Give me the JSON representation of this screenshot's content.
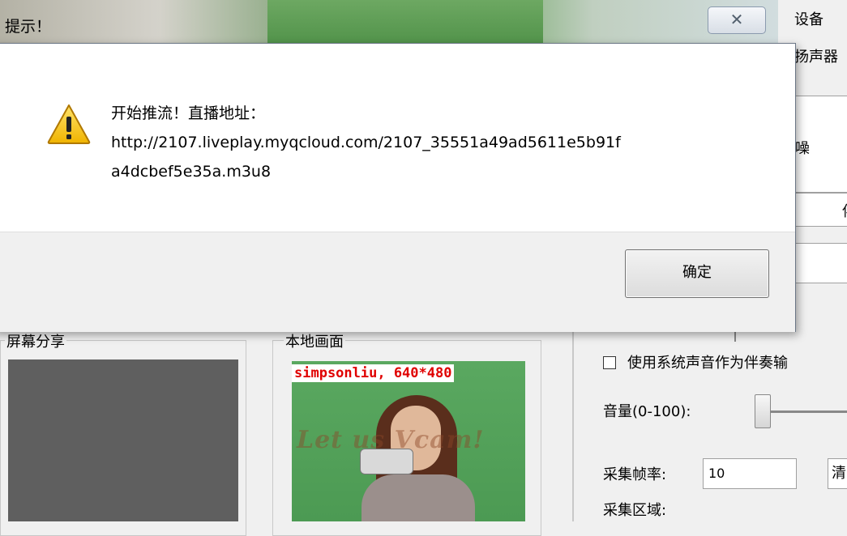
{
  "window": {
    "title": "提示！",
    "close_glyph": "✕"
  },
  "right_panel": {
    "device_label": "设备",
    "speaker_label": "扬声器",
    "noise_label": "噪",
    "accompany_label": "伴"
  },
  "groups": {
    "screen_share_label": "屏幕分享",
    "local_view_label": "本地画面"
  },
  "video": {
    "caption": "simpsonliu, 640*480",
    "watermark": "Let us Vcam!"
  },
  "settings": {
    "system_audio_label": "使用系统声音作为伴奏输",
    "volume_label": "音量(0-100):",
    "fps_label": "采集帧率:",
    "fps_value": "10",
    "quality_value": "清",
    "capture_area_label": "采集区域:"
  },
  "dialog": {
    "message_line1": "开始推流！直播地址：",
    "message_line2": "http://2107.liveplay.myqcloud.com/2107_35551a49ad5611e5b91f",
    "message_line3": "a4dcbef5e35a.m3u8",
    "ok_label": "确定",
    "icon": "warning-icon"
  }
}
